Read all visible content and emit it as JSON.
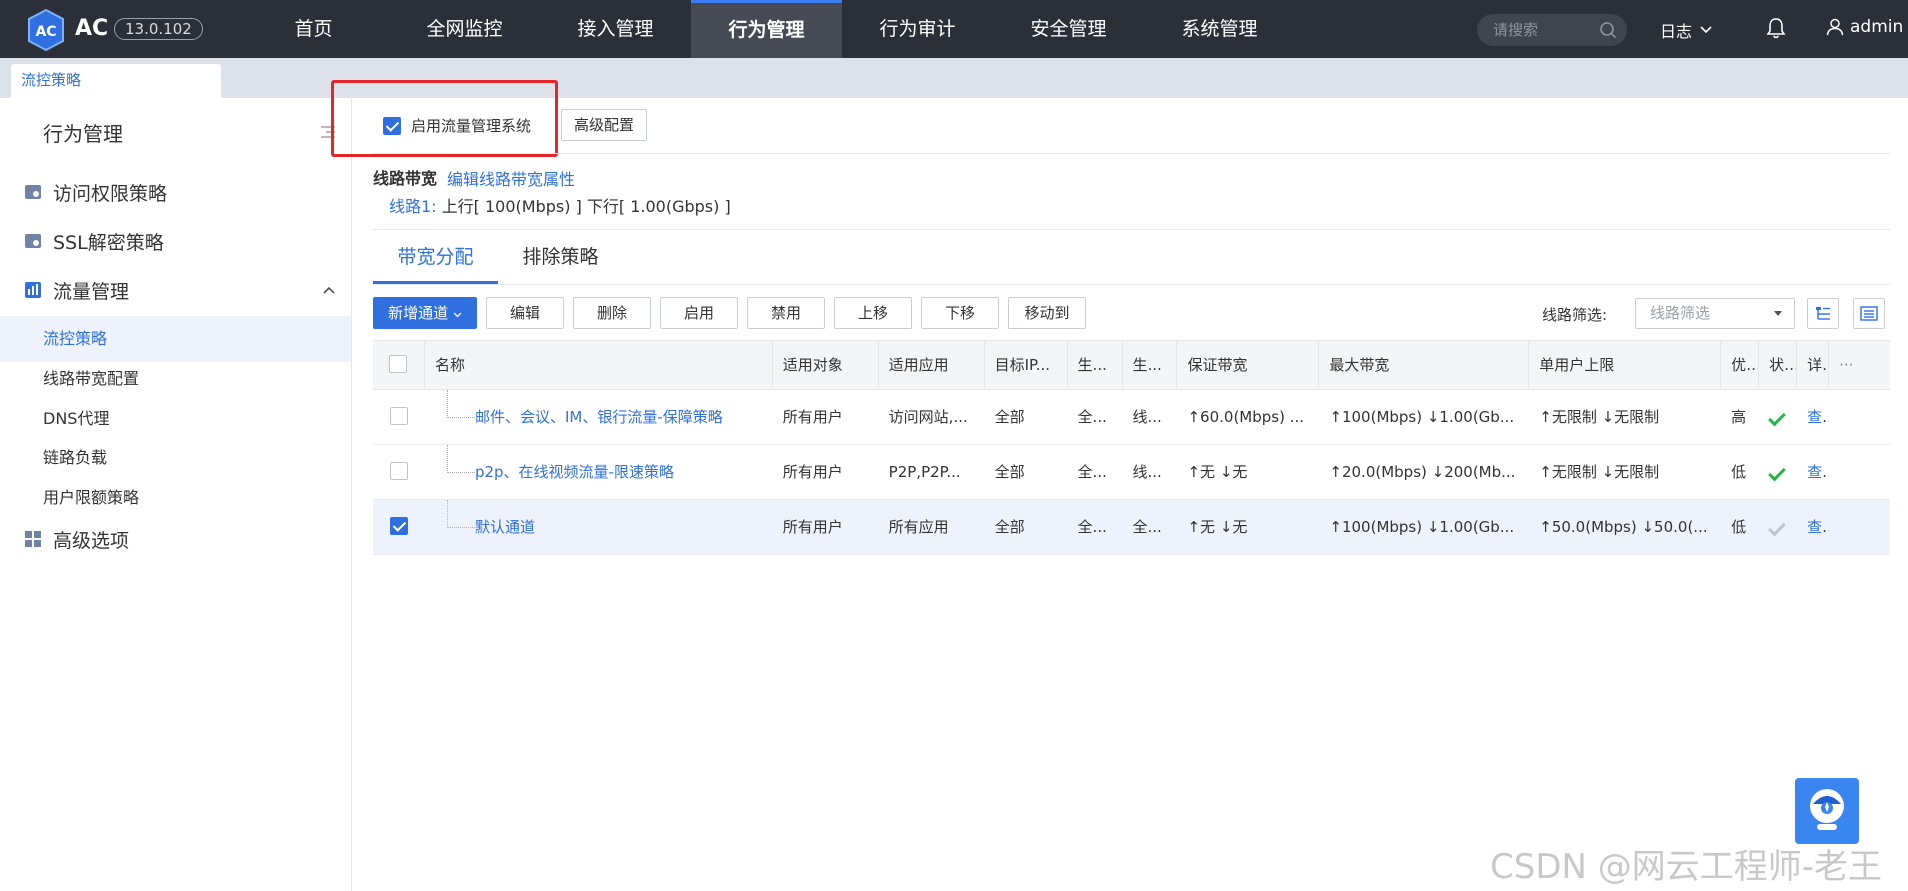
{
  "app": {
    "brand": "AC",
    "version": "13.0.102"
  },
  "nav": [
    "首页",
    "全网监控",
    "接入管理",
    "行为管理",
    "行为审计",
    "安全管理",
    "系统管理"
  ],
  "search": {
    "placeholder": "请搜索"
  },
  "header": {
    "log_label": "日志",
    "user": "admin"
  },
  "page_tab": "流控策略",
  "sidebar": {
    "title": "行为管理",
    "groups": [
      "访问权限策略",
      "SSL解密策略",
      "流量管理",
      "高级选项"
    ],
    "sub_items": [
      "流控策略",
      "线路带宽配置",
      "DNS代理",
      "链路负载",
      "用户限额策略"
    ]
  },
  "enable": {
    "label": "启用流量管理系统",
    "adv_button": "高级配置"
  },
  "bandwidth": {
    "title": "线路带宽",
    "edit_link": "编辑线路带宽属性",
    "line1_label": "线路1:",
    "line1_value": "上行[ 100(Mbps) ] 下行[ 1.00(Gbps) ]"
  },
  "subtabs": [
    "带宽分配",
    "排除策略"
  ],
  "toolbar": {
    "add": "新增通道",
    "buttons": [
      "编辑",
      "删除",
      "启用",
      "禁用",
      "上移",
      "下移",
      "移动到"
    ],
    "filter_label": "线路筛选:",
    "filter_placeholder": "线路筛选"
  },
  "table": {
    "headers": [
      "名称",
      "适用对象",
      "适用应用",
      "目标IP...",
      "生...",
      "生...",
      "保证带宽",
      "最大带宽",
      "单用户上限",
      "优...",
      "状...",
      "详...",
      "···"
    ],
    "rows": [
      {
        "name": "邮件、会议、IM、银行流量-保障策略",
        "target": "所有用户",
        "app": "访问网站,...",
        "ip": "全部",
        "c5": "全...",
        "c6": "线...",
        "guarantee": "↑60.0(Mbps) ...",
        "max": "↑100(Mbps) ↓1.00(Gb...",
        "per_user": "↑无限制 ↓无限制",
        "priority": "高",
        "status": "enabled",
        "detail": "查...",
        "checked": false
      },
      {
        "name": "p2p、在线视频流量-限速策略",
        "target": "所有用户",
        "app": "P2P,P2P...",
        "ip": "全部",
        "c5": "全...",
        "c6": "线...",
        "guarantee": "↑无 ↓无",
        "max": "↑20.0(Mbps) ↓200(Mb...",
        "per_user": "↑无限制 ↓无限制",
        "priority": "低",
        "status": "enabled",
        "detail": "查...",
        "checked": false
      },
      {
        "name": "默认通道",
        "target": "所有用户",
        "app": "所有应用",
        "ip": "全部",
        "c5": "全...",
        "c6": "全...",
        "guarantee": "↑无 ↓无",
        "max": "↑100(Mbps) ↓1.00(Gb...",
        "per_user": "↑50.0(Mbps) ↓50.0(...",
        "priority": "低",
        "status": "disabled",
        "detail": "查...",
        "checked": true
      }
    ]
  },
  "watermark": "CSDN @网云工程师-老王",
  "colors": {
    "accent": "#2f6fe0",
    "topbar": "#2b2f38",
    "highlight": "#e4262b",
    "ok": "#27b24a"
  }
}
